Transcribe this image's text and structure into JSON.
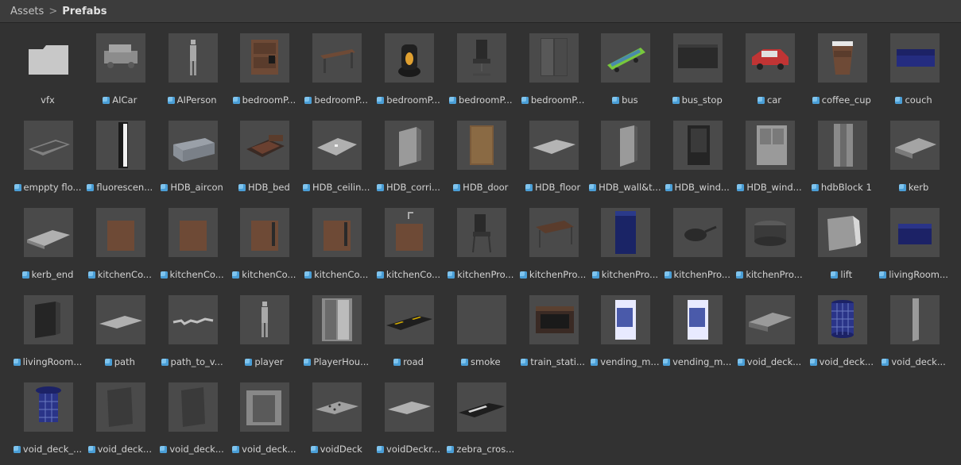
{
  "breadcrumb": {
    "root": "Assets",
    "separator": ">",
    "current": "Prefabs"
  },
  "items": [
    {
      "label": "vfx",
      "kind": "folder"
    },
    {
      "label": "AICar",
      "kind": "prefab"
    },
    {
      "label": "AIPerson",
      "kind": "prefab"
    },
    {
      "label": "bedroomP...",
      "kind": "prefab"
    },
    {
      "label": "bedroomP...",
      "kind": "prefab"
    },
    {
      "label": "bedroomP...",
      "kind": "prefab"
    },
    {
      "label": "bedroomP...",
      "kind": "prefab"
    },
    {
      "label": "bedroomP...",
      "kind": "prefab"
    },
    {
      "label": "bus",
      "kind": "prefab"
    },
    {
      "label": "bus_stop",
      "kind": "prefab"
    },
    {
      "label": "car",
      "kind": "prefab"
    },
    {
      "label": "coffee_cup",
      "kind": "prefab"
    },
    {
      "label": "couch",
      "kind": "prefab"
    },
    {
      "label": "emppty flo...",
      "kind": "prefab"
    },
    {
      "label": "fluorescen...",
      "kind": "prefab"
    },
    {
      "label": "HDB_aircon",
      "kind": "prefab"
    },
    {
      "label": "HDB_bed",
      "kind": "prefab"
    },
    {
      "label": "HDB_ceilin...",
      "kind": "prefab"
    },
    {
      "label": "HDB_corri...",
      "kind": "prefab"
    },
    {
      "label": "HDB_door",
      "kind": "prefab"
    },
    {
      "label": "HDB_floor",
      "kind": "prefab"
    },
    {
      "label": "HDB_wall&t...",
      "kind": "prefab"
    },
    {
      "label": "HDB_wind...",
      "kind": "prefab"
    },
    {
      "label": "HDB_wind...",
      "kind": "prefab"
    },
    {
      "label": "hdbBlock 1",
      "kind": "prefab"
    },
    {
      "label": "kerb",
      "kind": "prefab"
    },
    {
      "label": "kerb_end",
      "kind": "prefab"
    },
    {
      "label": "kitchenCo...",
      "kind": "prefab"
    },
    {
      "label": "kitchenCo...",
      "kind": "prefab"
    },
    {
      "label": "kitchenCo...",
      "kind": "prefab"
    },
    {
      "label": "kitchenCo...",
      "kind": "prefab"
    },
    {
      "label": "kitchenCo...",
      "kind": "prefab"
    },
    {
      "label": "kitchenPro...",
      "kind": "prefab"
    },
    {
      "label": "kitchenPro...",
      "kind": "prefab"
    },
    {
      "label": "kitchenPro...",
      "kind": "prefab"
    },
    {
      "label": "kitchenPro...",
      "kind": "prefab"
    },
    {
      "label": "kitchenPro...",
      "kind": "prefab"
    },
    {
      "label": "lift",
      "kind": "prefab"
    },
    {
      "label": "livingRoom...",
      "kind": "prefab"
    },
    {
      "label": "livingRoom...",
      "kind": "prefab"
    },
    {
      "label": "path",
      "kind": "prefab"
    },
    {
      "label": "path_to_v...",
      "kind": "prefab"
    },
    {
      "label": "player",
      "kind": "prefab"
    },
    {
      "label": "PlayerHou...",
      "kind": "prefab"
    },
    {
      "label": "road",
      "kind": "prefab"
    },
    {
      "label": "smoke",
      "kind": "prefab"
    },
    {
      "label": "train_stati...",
      "kind": "prefab"
    },
    {
      "label": "vending_m...",
      "kind": "prefab"
    },
    {
      "label": "vending_m...",
      "kind": "prefab"
    },
    {
      "label": "void_deck...",
      "kind": "prefab"
    },
    {
      "label": "void_deck...",
      "kind": "prefab"
    },
    {
      "label": "void_deck...",
      "kind": "prefab"
    },
    {
      "label": "void_deck_...",
      "kind": "prefab"
    },
    {
      "label": "void_deck...",
      "kind": "prefab"
    },
    {
      "label": "void_deck...",
      "kind": "prefab"
    },
    {
      "label": "void_deck...",
      "kind": "prefab"
    },
    {
      "label": "voidDeck",
      "kind": "prefab"
    },
    {
      "label": "voidDeckr...",
      "kind": "prefab"
    },
    {
      "label": "zebra_cros...",
      "kind": "prefab"
    }
  ]
}
